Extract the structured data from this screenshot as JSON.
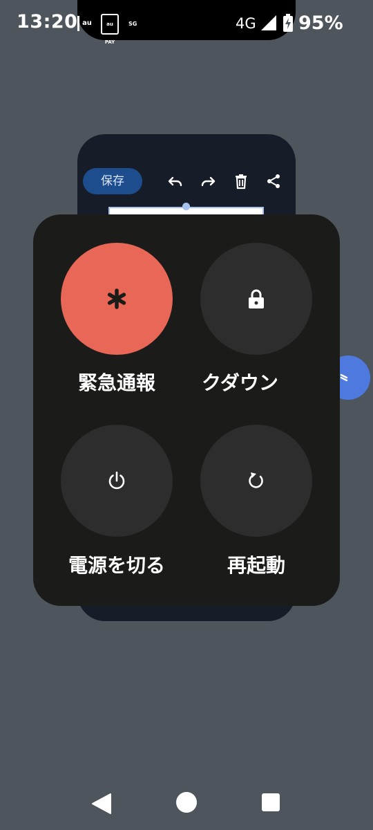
{
  "status_bar": {
    "time": "13:20",
    "network": "4G",
    "battery_percent": "95%",
    "notification_icons": [
      "au",
      "au PAY",
      "SG"
    ]
  },
  "background_app": {
    "save_label": "保存",
    "toolbar_icons": [
      "undo-icon",
      "redo-icon",
      "delete-icon",
      "share-icon"
    ]
  },
  "power_menu": {
    "emergency_label": "緊急通報",
    "lockdown_label": "ロックダウン",
    "power_off_label": "電源を切る",
    "restart_label": "再起動"
  },
  "colors": {
    "emergency": "#e86756",
    "menu_background": "#1b1c19",
    "button_background": "#2d2d2d",
    "save_button": "#1e4d8e"
  },
  "nav_bar": {
    "buttons": [
      "back-icon",
      "home-icon",
      "recents-icon"
    ]
  }
}
